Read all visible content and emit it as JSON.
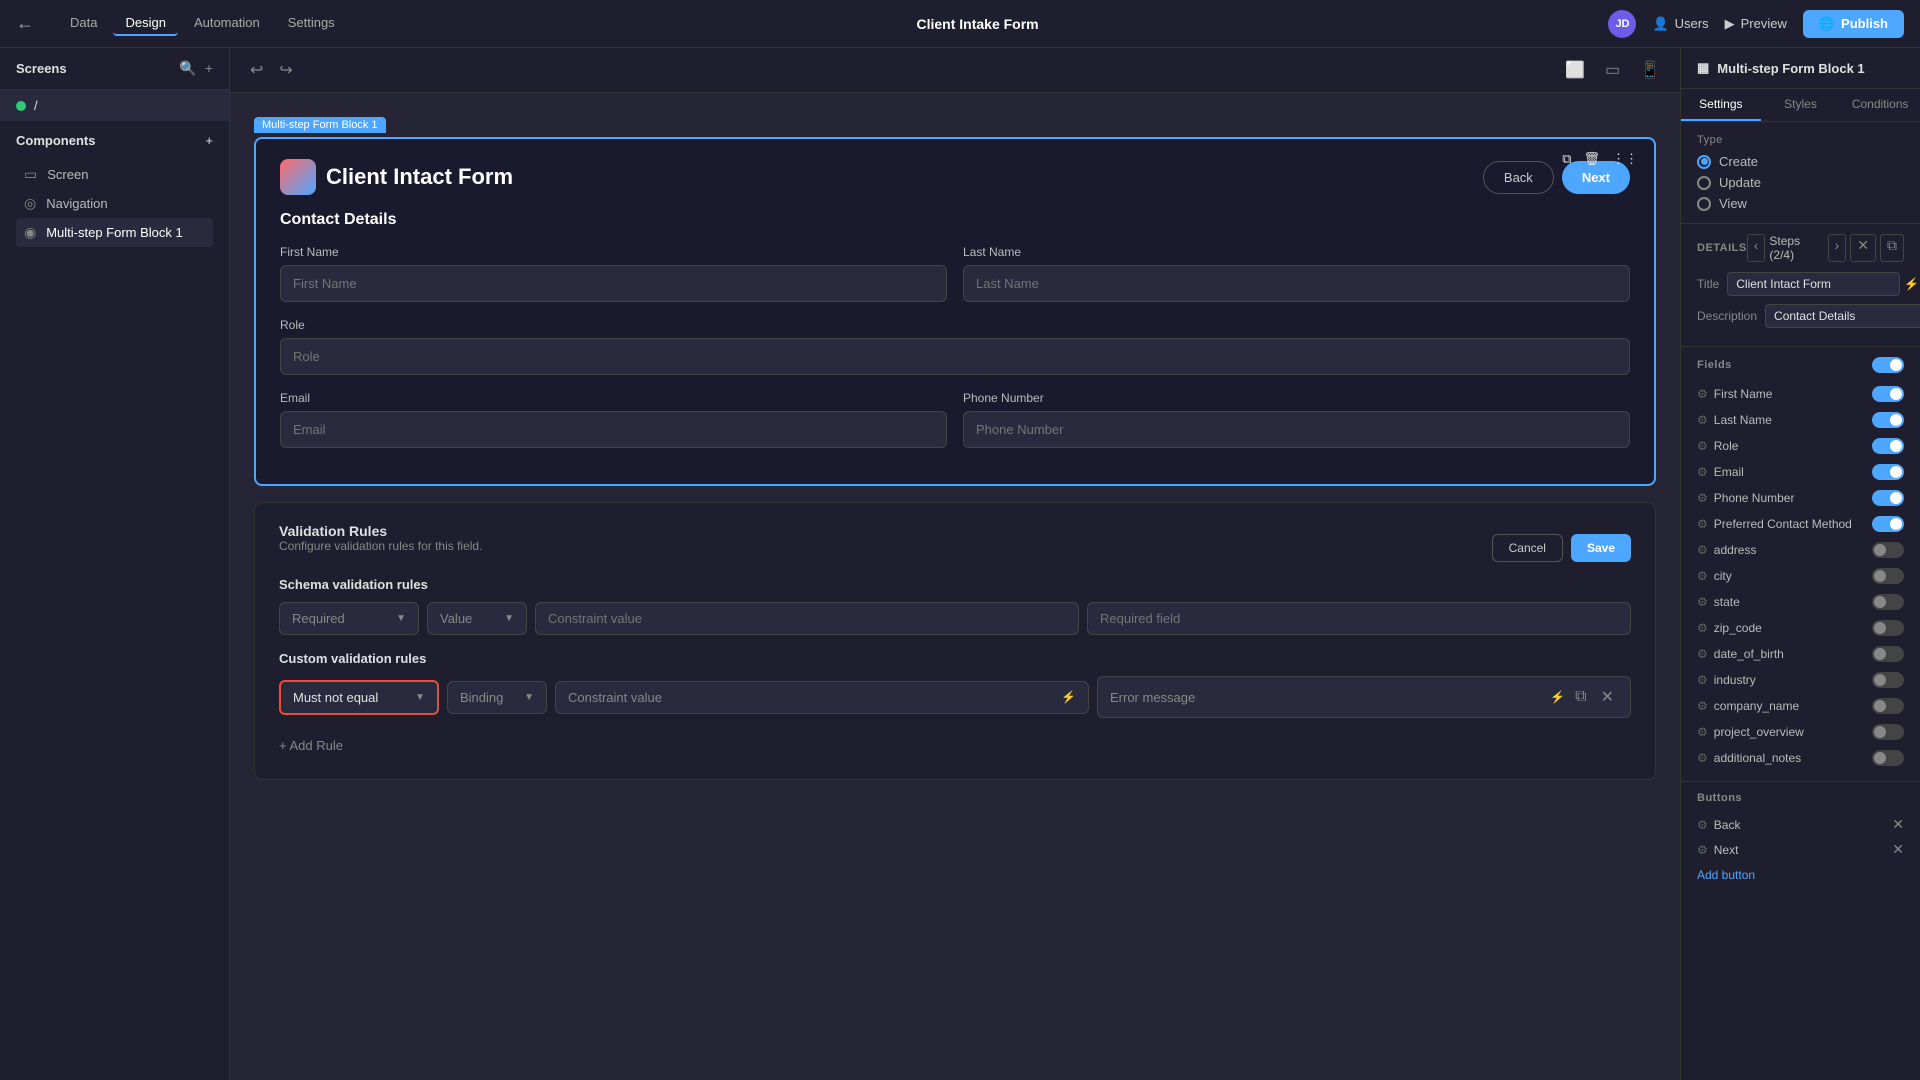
{
  "topNav": {
    "backIcon": "←",
    "tabs": [
      {
        "label": "Data",
        "active": false
      },
      {
        "label": "Design",
        "active": true
      },
      {
        "label": "Automation",
        "active": false
      },
      {
        "label": "Settings",
        "active": false
      }
    ],
    "centerTitle": "Client Intake Form",
    "avatar": "JD",
    "usersLabel": "Users",
    "previewLabel": "Preview",
    "publishLabel": "Publish"
  },
  "leftSidebar": {
    "screensTitle": "Screens",
    "screenItem": "/",
    "componentsTitle": "Components",
    "components": [
      {
        "icon": "▭",
        "label": "Screen"
      },
      {
        "icon": "◎",
        "label": "Navigation"
      },
      {
        "icon": "◉",
        "label": "Multi-step Form Block 1",
        "selected": true
      }
    ]
  },
  "canvasToolbar": {
    "undoIcon": "↩",
    "redoIcon": "↪",
    "desktopIcon": "⬜",
    "tabletIcon": "▭",
    "mobileIcon": "📱"
  },
  "formCard": {
    "badge": "Multi-step Form Block 1",
    "title": "Client Intact Form",
    "backBtn": "Back",
    "nextBtn": "Next",
    "sectionTitle": "Contact Details",
    "fields": {
      "firstNameLabel": "First Name",
      "firstNamePlaceholder": "First Name",
      "lastNameLabel": "Last Name",
      "lastNamePlaceholder": "Last Name",
      "roleLabel": "Role",
      "rolePlaceholder": "Role",
      "emailLabel": "Email",
      "emailPlaceholder": "Email",
      "phoneLabel": "Phone Number",
      "phonePlaceholder": "Phone Number"
    }
  },
  "validationSection": {
    "title": "Validation Rules",
    "subtitle": "Configure validation rules for this field.",
    "cancelBtn": "Cancel",
    "saveBtn": "Save",
    "schemaTitle": "Schema validation rules",
    "schemaRule": "Required",
    "schemaValuePlaceholder": "Value",
    "schemaConstraintPlaceholder": "Constraint value",
    "schemaResultPlaceholder": "Required field",
    "customTitle": "Custom validation rules",
    "customRule": "Must not equal",
    "bindingLabel": "Binding",
    "constraintPlaceholder": "Constraint value",
    "errorPlaceholder": "Error message",
    "addRuleLabel": "+ Add Rule"
  },
  "rightPanel": {
    "headerTitle": "Multi-step Form Block 1",
    "tabs": [
      "Settings",
      "Styles",
      "Conditions"
    ],
    "typeLabel": "Type",
    "typeOptions": [
      "Create",
      "Update",
      "View"
    ],
    "detailsLabel": "DETAILS",
    "stepsLabel": "Steps (2/4)",
    "titleFieldLabel": "Title",
    "titleFieldValue": "Client Intact Form",
    "descFieldLabel": "Description",
    "descFieldValue": "Contact Details",
    "fieldsLabel": "Fields",
    "fields": [
      {
        "name": "First Name",
        "on": true
      },
      {
        "name": "Last Name",
        "on": true
      },
      {
        "name": "Role",
        "on": true
      },
      {
        "name": "Email",
        "on": true
      },
      {
        "name": "Phone Number",
        "on": true
      },
      {
        "name": "Preferred Contact Method",
        "on": true
      },
      {
        "name": "address",
        "on": false
      },
      {
        "name": "city",
        "on": false
      },
      {
        "name": "state",
        "on": false
      },
      {
        "name": "zip_code",
        "on": false
      },
      {
        "name": "date_of_birth",
        "on": false
      },
      {
        "name": "industry",
        "on": false
      },
      {
        "name": "company_name",
        "on": false
      },
      {
        "name": "project_overview",
        "on": false
      },
      {
        "name": "additional_notes",
        "on": false
      }
    ],
    "buttonsLabel": "Buttons",
    "buttons": [
      "Back",
      "Next"
    ],
    "addButtonLabel": "Add button"
  }
}
